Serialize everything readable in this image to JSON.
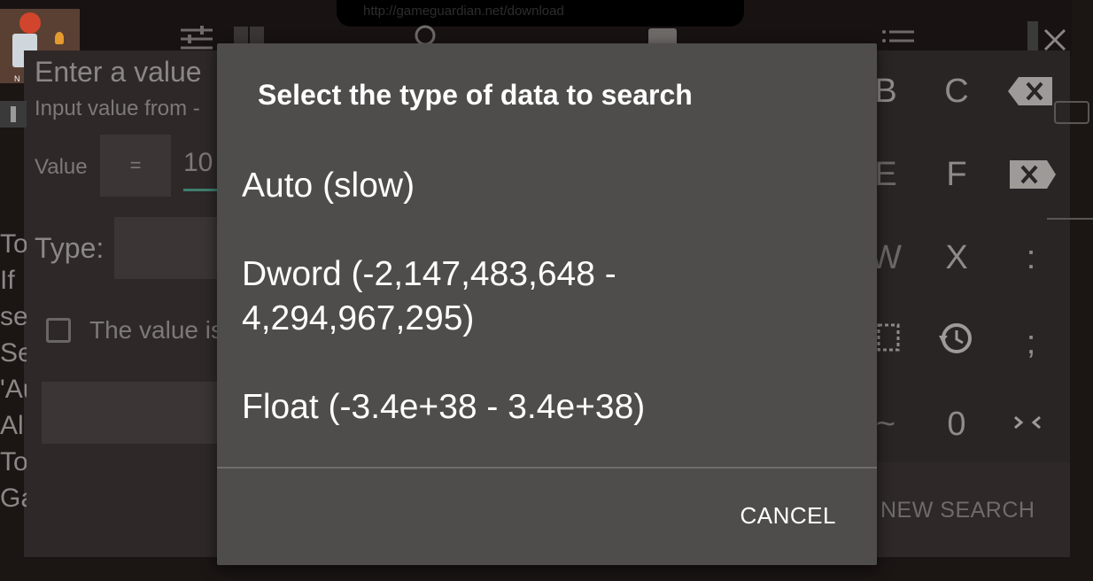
{
  "url_bar": {
    "text": "http://gameguardian.net/download"
  },
  "app_thumbnail": {
    "label": "N"
  },
  "background_dialog": {
    "title": "Enter a value",
    "subtitle": "Input value from -",
    "value_label": "Value",
    "operator": "=",
    "value_text": "10",
    "type_label": "Type:",
    "checkbox_label": "The value is"
  },
  "left_strip": [
    "To",
    "If",
    "se",
    "Se",
    "'Au",
    "Al",
    "To",
    "Ga"
  ],
  "keypad": {
    "keys": [
      "B",
      "C",
      "E",
      "F",
      "W",
      "X",
      ":",
      ";",
      "~",
      "0"
    ],
    "new_search_label": "NEW SEARCH"
  },
  "dialog": {
    "title": "Select the type of data to search",
    "options": [
      {
        "label": "Auto (slow)"
      },
      {
        "label": "Dword (-2,147,483,648 - 4,294,967,295)"
      },
      {
        "label": "Float (-3.4e+38 - 3.4e+38)"
      }
    ],
    "cancel_label": "CANCEL"
  }
}
